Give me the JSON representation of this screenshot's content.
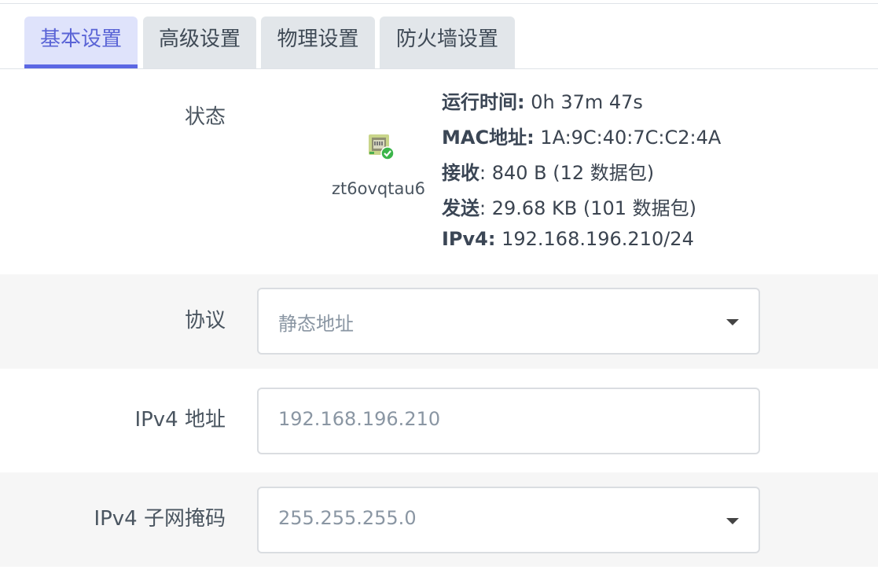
{
  "tabs": [
    {
      "label": "基本设置",
      "active": true
    },
    {
      "label": "高级设置",
      "active": false
    },
    {
      "label": "物理设置",
      "active": false
    },
    {
      "label": "防火墙设置",
      "active": false
    }
  ],
  "status": {
    "label": "状态",
    "interface_name": "zt6ovqtau6",
    "icon": "ethernet-port-connected-icon",
    "uptime_label": "运行时间:",
    "uptime_value": " 0h 37m 47s",
    "mac_label": "MAC地址:",
    "mac_value": " 1A:9C:40:7C:C2:4A",
    "rx_label": "接收",
    "rx_value": ": 840 B (12 数据包)",
    "tx_label": "发送",
    "tx_value": ": 29.68 KB (101 数据包)",
    "ipv4_label": "IPv4:",
    "ipv4_value": " 192.168.196.210/24"
  },
  "fields": {
    "protocol": {
      "label": "协议",
      "value": "静态地址"
    },
    "ipv4_address": {
      "label": "IPv4 地址",
      "value": "192.168.196.210"
    },
    "ipv4_netmask": {
      "label": "IPv4 子网掩码",
      "value": "255.255.255.0"
    }
  },
  "colors": {
    "accent": "#5b67e3",
    "tab_bg": "#e2e6ea",
    "active_tab_bg": "#dfe3fb",
    "shaded_row": "#f6f6f6"
  }
}
